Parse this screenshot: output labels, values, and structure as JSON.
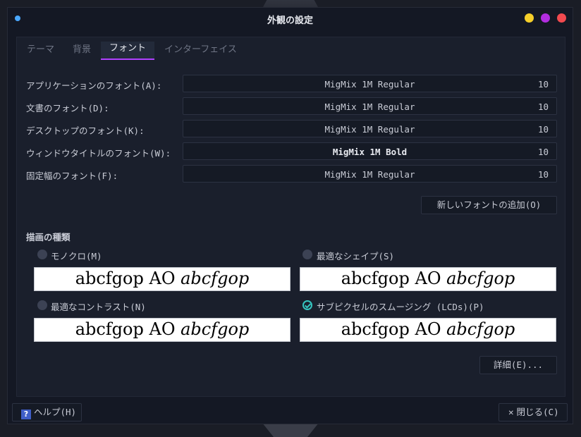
{
  "window": {
    "title": "外観の設定",
    "controls": {
      "minimize_color": "#f6cf2a",
      "maximize_color": "#b22de0",
      "close_color": "#f24a4f"
    }
  },
  "tabs": [
    {
      "label": "テーマ",
      "active": false
    },
    {
      "label": "背景",
      "active": false
    },
    {
      "label": "フォント",
      "active": true
    },
    {
      "label": "インターフェイス",
      "active": false
    }
  ],
  "fonts": [
    {
      "label": "アプリケーションのフォント(A):",
      "font": "MigMix 1M Regular",
      "size": "10"
    },
    {
      "label": "文書のフォント(D):",
      "font": "MigMix 1M Regular",
      "size": "10"
    },
    {
      "label": "デスクトップのフォント(K):",
      "font": "MigMix 1M Regular",
      "size": "10"
    },
    {
      "label": "ウィンドウタイトルのフォント(W):",
      "font": "MigMix 1M Bold",
      "size": "10"
    },
    {
      "label": "固定幅のフォント(F):",
      "font": "MigMix 1M Regular",
      "size": "10"
    }
  ],
  "add_font_button": "新しいフォントの追加(O)",
  "rendering": {
    "section_title": "描画の種類",
    "options": [
      {
        "label": "モノクロ(M)",
        "selected": false
      },
      {
        "label": "最適なシェイプ(S)",
        "selected": false
      },
      {
        "label": "最適なコントラスト(N)",
        "selected": false
      },
      {
        "label": "サブピクセルのスムージング (LCDs)(P)",
        "selected": true
      }
    ],
    "preview_text": "abcfgop AO ",
    "preview_italic": "abcfgop"
  },
  "details_button": "詳細(E)...",
  "footer": {
    "help_label": "ヘルプ(H)",
    "help_icon": "?",
    "close_label": "閉じる(C)",
    "close_icon": "✕"
  },
  "accent_color": "#b040ff"
}
